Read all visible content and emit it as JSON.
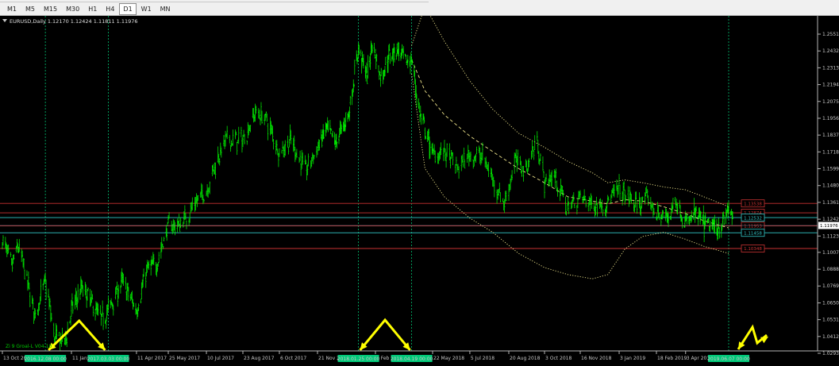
{
  "toolbar": {
    "timeframes": [
      {
        "label": "M1",
        "active": false
      },
      {
        "label": "M5",
        "active": false
      },
      {
        "label": "M15",
        "active": false
      },
      {
        "label": "M30",
        "active": false
      },
      {
        "label": "H1",
        "active": false
      },
      {
        "label": "H4",
        "active": false
      },
      {
        "label": "D1",
        "active": true
      },
      {
        "label": "W1",
        "active": false
      },
      {
        "label": "MN",
        "active": false
      }
    ]
  },
  "chart_title": "EURUSD,Daily  1.12170 1.12424 1.11811 1.11976",
  "indicator_label": "Zi 9 Groal-L V04-10",
  "colors": {
    "background": "#000000",
    "candles": "#00ff00",
    "envelope": "#f0e68c",
    "grid_vline": "#00c070",
    "arrow": "#ffff00",
    "line_red": "#c83232",
    "line_cyan": "#32c8c8",
    "line_pink": "#ff50c8",
    "current_price_bg": "#ffffff"
  },
  "chart_data": {
    "type": "line",
    "symbol": "EURUSD",
    "timeframe": "Daily",
    "ohlc": {
      "open": "1.12170",
      "high": "1.12424",
      "low": "1.11811",
      "close": "1.11976"
    },
    "y_ticks": [
      "1.25510",
      "1.24320",
      "1.23130",
      "1.21940",
      "1.20750",
      "1.19560",
      "1.18370",
      "1.17180",
      "1.15990",
      "1.14800",
      "1.13610",
      "1.12420",
      "1.11230",
      "1.10075",
      "1.08880",
      "1.07695",
      "1.06500",
      "1.05315",
      "1.04125",
      "1.02935"
    ],
    "x_ticks": [
      {
        "date": "2016-10-13",
        "label": "13 Oct 20"
      },
      {
        "date": "2017-01-11",
        "label": "11 Jan 2"
      },
      {
        "date": "2017-04-11",
        "label": "11 Apr 2017"
      },
      {
        "date": "2017-05-25",
        "label": "25 May 2017"
      },
      {
        "date": "2017-07-10",
        "label": "10 Jul 2017"
      },
      {
        "date": "2017-08-23",
        "label": "23 Aug 2017"
      },
      {
        "date": "2017-10-06",
        "label": "6 Oct 2017"
      },
      {
        "date": "2017-11-21",
        "label": "21 Nov 201"
      },
      {
        "date": "2018-02-21",
        "label": "1 Feb 20"
      },
      {
        "date": "2018-05-22",
        "label": "22 May 2018"
      },
      {
        "date": "2018-07-05",
        "label": "5 Jul 2018"
      },
      {
        "date": "2018-08-20",
        "label": "20 Aug 2018"
      },
      {
        "date": "2018-10-03",
        "label": "3 Oct 2018"
      },
      {
        "date": "2018-11-16",
        "label": "16 Nov 2018"
      },
      {
        "date": "2019-01-03",
        "label": "3 Jan 2019"
      },
      {
        "date": "2019-02-18",
        "label": "18 Feb 2019"
      },
      {
        "date": "2019-04-03",
        "label": "3 Apr 2019"
      }
    ],
    "vertical_markers": [
      {
        "date": "2016-12-08",
        "label": "2016.12.08 00:00"
      },
      {
        "date": "2017-03-03",
        "label": "2017.03.03 00:00"
      },
      {
        "date": "2018-01-25",
        "label": "2018.01.25 00:00"
      },
      {
        "date": "2018-04-19",
        "label": "2018.04.19 00:00"
      },
      {
        "date": "2019-06-07",
        "label": "2019.06.07 00:00"
      }
    ],
    "price_series": [
      [
        "2016-10-13",
        1.11
      ],
      [
        "2016-10-25",
        1.09
      ],
      [
        "2016-11-02",
        1.105
      ],
      [
        "2016-11-10",
        1.09
      ],
      [
        "2016-11-24",
        1.057
      ],
      [
        "2016-12-08",
        1.08
      ],
      [
        "2016-12-20",
        1.04
      ],
      [
        "2017-01-03",
        1.038
      ],
      [
        "2017-01-11",
        1.06
      ],
      [
        "2017-01-25",
        1.075
      ],
      [
        "2017-02-08",
        1.065
      ],
      [
        "2017-02-21",
        1.053
      ],
      [
        "2017-03-03",
        1.06
      ],
      [
        "2017-03-22",
        1.08
      ],
      [
        "2017-04-11",
        1.06
      ],
      [
        "2017-04-25",
        1.088
      ],
      [
        "2017-05-08",
        1.092
      ],
      [
        "2017-05-25",
        1.12
      ],
      [
        "2017-06-08",
        1.12
      ],
      [
        "2017-06-26",
        1.135
      ],
      [
        "2017-07-10",
        1.145
      ],
      [
        "2017-07-25",
        1.17
      ],
      [
        "2017-08-03",
        1.18
      ],
      [
        "2017-08-23",
        1.18
      ],
      [
        "2017-09-07",
        1.2
      ],
      [
        "2017-09-20",
        1.195
      ],
      [
        "2017-10-06",
        1.172
      ],
      [
        "2017-10-20",
        1.18
      ],
      [
        "2017-11-07",
        1.158
      ],
      [
        "2017-11-21",
        1.175
      ],
      [
        "2017-12-05",
        1.188
      ],
      [
        "2017-12-20",
        1.178
      ],
      [
        "2018-01-10",
        1.2
      ],
      [
        "2018-01-25",
        1.245
      ],
      [
        "2018-02-08",
        1.225
      ],
      [
        "2018-02-16",
        1.25
      ],
      [
        "2018-03-01",
        1.225
      ],
      [
        "2018-03-15",
        1.24
      ],
      [
        "2018-03-27",
        1.245
      ],
      [
        "2018-04-10",
        1.235
      ],
      [
        "2018-04-19",
        1.237
      ],
      [
        "2018-05-01",
        1.2
      ],
      [
        "2018-05-22",
        1.17
      ],
      [
        "2018-06-05",
        1.172
      ],
      [
        "2018-06-20",
        1.16
      ],
      [
        "2018-07-05",
        1.17
      ],
      [
        "2018-07-20",
        1.168
      ],
      [
        "2018-08-15",
        1.135
      ],
      [
        "2018-08-27",
        1.165
      ],
      [
        "2018-09-10",
        1.16
      ],
      [
        "2018-09-24",
        1.18
      ],
      [
        "2018-10-03",
        1.15
      ],
      [
        "2018-10-15",
        1.155
      ],
      [
        "2018-10-31",
        1.132
      ],
      [
        "2018-11-16",
        1.14
      ],
      [
        "2018-12-01",
        1.135
      ],
      [
        "2018-12-17",
        1.135
      ],
      [
        "2019-01-03",
        1.145
      ],
      [
        "2019-01-24",
        1.134
      ],
      [
        "2019-02-08",
        1.138
      ],
      [
        "2019-02-18",
        1.128
      ],
      [
        "2019-03-05",
        1.125
      ],
      [
        "2019-03-20",
        1.138
      ],
      [
        "2019-04-03",
        1.12
      ],
      [
        "2019-04-17",
        1.128
      ],
      [
        "2019-05-02",
        1.12
      ],
      [
        "2019-05-21",
        1.118
      ],
      [
        "2019-05-31",
        1.123
      ],
      [
        "2019-06-07",
        1.133
      ],
      [
        "2019-06-14",
        1.12
      ]
    ],
    "horizontal_levels": [
      {
        "label": "1.13538",
        "color": "#c83232"
      },
      {
        "label": "1.12874",
        "color": "#c83232"
      },
      {
        "label": "1.12532",
        "color": "#32c8c8"
      },
      {
        "label": "1.11953",
        "color": "#c83232"
      },
      {
        "label": "1.11458",
        "color": "#32c8c8"
      },
      {
        "label": "1.10348",
        "color": "#c83232"
      }
    ],
    "current_price": "1.11976",
    "grid": false,
    "y_axis_side": "right"
  }
}
